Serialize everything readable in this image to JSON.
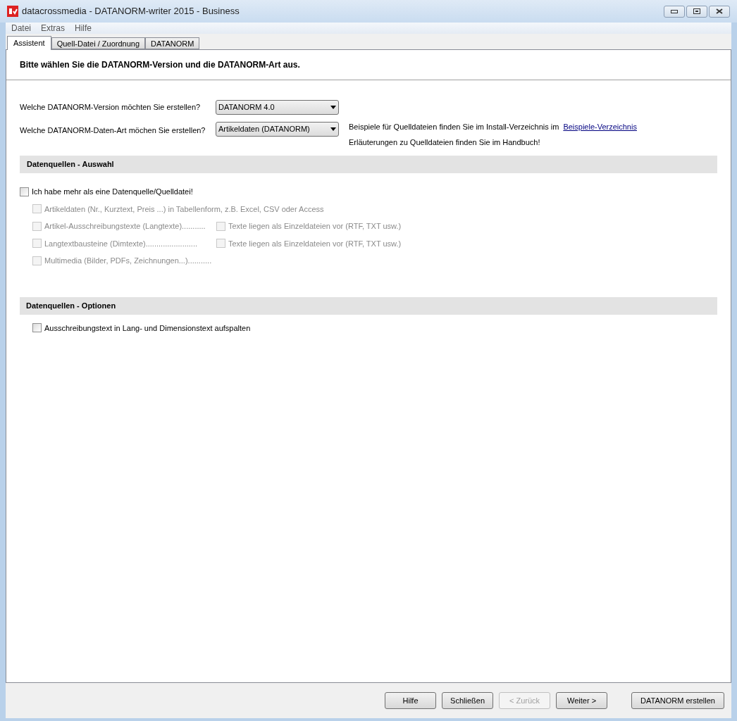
{
  "window": {
    "title": "datacrossmedia - DATANORM-writer 2015 - Business"
  },
  "menu": [
    "Datei",
    "Extras",
    "Hilfe"
  ],
  "tabs": [
    {
      "label": "Assistent",
      "selected": true
    },
    {
      "label": "Quell-Datei / Zuordnung",
      "selected": false
    },
    {
      "label": "DATANORM",
      "selected": false
    }
  ],
  "heading": "Bitte wählen Sie die DATANORM-Version und die DATANORM-Art aus.",
  "version": {
    "label": "Welche DATANORM-Version möchten Sie erstellen?",
    "value": "DATANORM 4.0"
  },
  "data_type": {
    "label": "Welche DATANORM-Daten-Art möchen Sie erstellen?",
    "value": "Artikeldaten (DATANORM)"
  },
  "info": {
    "line_1": "Beispiele für Quelldateien finden Sie im Install-Verzeichnis im",
    "link": "Beispiele-Verzeichnis",
    "line_2": "Erläuterungen zu Quelldateien finden Sie im Handbuch!"
  },
  "sources": {
    "title": "Datenquellen - Auswahl",
    "multi": {
      "label": "Ich habe mehr als eine Datenquelle/Quelldatei!",
      "checked": false,
      "disabled": false
    },
    "items": [
      {
        "label": "Artikeldaten (Nr., Kurztext, Preis ...) in Tabellenform, z.B. Excel, CSV oder Access",
        "checked": false,
        "disabled": true
      },
      {
        "label": "Artikel-Ausschreibungstexte (Langtexte)...........",
        "checked": false,
        "disabled": true,
        "extra": {
          "label": "Texte liegen als Einzeldateien vor (RTF, TXT usw.)",
          "checked": false,
          "disabled": true
        }
      },
      {
        "label": "Langtextbausteine (Dimtexte)........................",
        "checked": false,
        "disabled": true,
        "extra": {
          "label": "Texte liegen als Einzeldateien vor (RTF, TXT usw.)",
          "checked": false,
          "disabled": true
        }
      },
      {
        "label": "Multimedia (Bilder, PDFs, Zeichnungen...)...........",
        "checked": false,
        "disabled": true
      }
    ]
  },
  "options": {
    "title": "Datenquellen - Optionen",
    "items": [
      {
        "label": "Ausschreibungstext in Lang- und Dimensionstext aufspalten",
        "checked": false,
        "disabled": false
      }
    ]
  },
  "buttons": [
    {
      "label": "Hilfe",
      "disabled": false
    },
    {
      "label": "Schließen",
      "disabled": false
    },
    {
      "label": "< Zurück",
      "disabled": true
    },
    {
      "label": "Weiter >",
      "disabled": false
    },
    {
      "label": "DATANORM erstellen",
      "disabled": false
    }
  ]
}
